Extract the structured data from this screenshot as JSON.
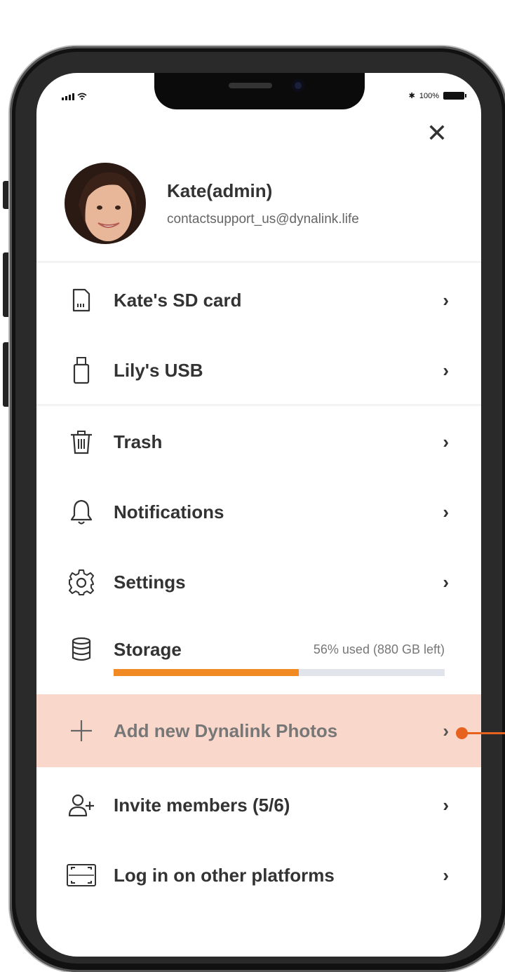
{
  "status": {
    "battery_text": "100%"
  },
  "profile": {
    "name": "Kate(admin)",
    "email": "contactsupport_us@dynalink.life"
  },
  "menu": {
    "sd_card": {
      "label": "Kate's SD card",
      "icon": "sd-card-icon"
    },
    "usb": {
      "label": "Lily's USB",
      "icon": "usb-icon"
    },
    "trash": {
      "label": "Trash",
      "icon": "trash-icon"
    },
    "notifications": {
      "label": "Notifications",
      "icon": "bell-icon"
    },
    "settings": {
      "label": "Settings",
      "icon": "gear-icon"
    },
    "storage": {
      "label": "Storage",
      "usage": "56% used (880 GB left)",
      "used_percent": 56,
      "icon": "database-icon"
    },
    "add_photos": {
      "label": "Add new Dynalink Photos",
      "icon": "plus-icon"
    },
    "invite": {
      "label": "Invite members (5/6)",
      "icon": "add-user-icon"
    },
    "other_platforms": {
      "label": "Log in on other platforms",
      "icon": "scan-icon"
    }
  },
  "colors": {
    "accent": "#f28a23",
    "highlight": "#f9d8cb",
    "callout": "#e8621f",
    "text": "#333333"
  }
}
